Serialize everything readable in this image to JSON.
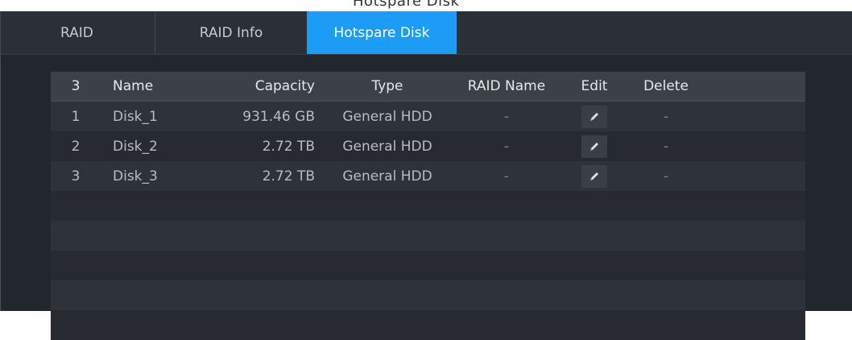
{
  "top_cutoff_text": "Hotspare Disk",
  "tabs": [
    {
      "label": "RAID",
      "active": false
    },
    {
      "label": "RAID Info",
      "active": false
    },
    {
      "label": "Hotspare Disk",
      "active": true
    }
  ],
  "table": {
    "headers": {
      "count": "3",
      "name": "Name",
      "capacity": "Capacity",
      "type": "Type",
      "raid_name": "RAID Name",
      "edit": "Edit",
      "delete": "Delete"
    },
    "rows": [
      {
        "num": "1",
        "name": "Disk_1",
        "capacity": "931.46 GB",
        "type": "General HDD",
        "raid_name": "-",
        "delete": "-"
      },
      {
        "num": "2",
        "name": "Disk_2",
        "capacity": "2.72 TB",
        "type": "General HDD",
        "raid_name": "-",
        "delete": "-"
      },
      {
        "num": "3",
        "name": "Disk_3",
        "capacity": "2.72 TB",
        "type": "General HDD",
        "raid_name": "-",
        "delete": "-"
      }
    ],
    "empty_rows": 5
  },
  "icons": {
    "edit": "pencil-icon"
  },
  "colors": {
    "active_tab": "#1c9cf6",
    "background": "#22262d",
    "header_row": "#3c4148"
  }
}
